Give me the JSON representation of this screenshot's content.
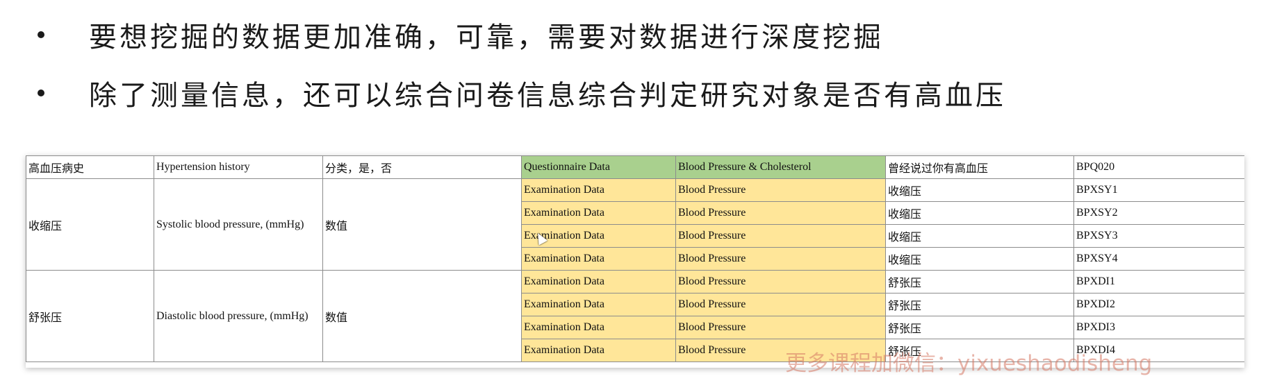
{
  "bullets": [
    {
      "text": "要想挖掘的数据更加准确，可靠，需要对数据进行深度挖掘"
    },
    {
      "text": "除了测量信息，还可以综合问卷信息综合判定研究对象是否有高血压"
    }
  ],
  "table": {
    "row0": [
      "高血压病史",
      "Hypertension history",
      "分类，是，否",
      "Questionnaire Data",
      "Blood Pressure & Cholesterol",
      "曾经说过你有高血压",
      "BPQ020"
    ],
    "systolic_group": {
      "name": "收缩压",
      "desc": "Systolic blood pressure, (mmHg)",
      "type": "数值",
      "rows": [
        [
          "Examination Data",
          "Blood Pressure",
          "收缩压",
          "BPXSY1"
        ],
        [
          "Examination Data",
          "Blood Pressure",
          "收缩压",
          "BPXSY2"
        ],
        [
          "Examination Data",
          "Blood Pressure",
          "收缩压",
          "BPXSY3"
        ],
        [
          "Examination Data",
          "Blood Pressure",
          "收缩压",
          "BPXSY4"
        ]
      ]
    },
    "diastolic_group": {
      "name": "舒张压",
      "desc": "Diastolic blood pressure, (mmHg)",
      "type": "数值",
      "rows": [
        [
          "Examination Data",
          "Blood Pressure",
          "舒张压",
          "BPXDI1"
        ],
        [
          "Examination Data",
          "Blood Pressure",
          "舒张压",
          "BPXDI2"
        ],
        [
          "Examination Data",
          "Blood Pressure",
          "舒张压",
          "BPXDI3"
        ],
        [
          "Examination Data",
          "Blood Pressure",
          "舒张压",
          "BPXDI4"
        ]
      ]
    }
  },
  "watermark": "更多课程加微信：yixueshaodisheng",
  "colors": {
    "questionnaire_fill": "#a9d08e",
    "examination_fill": "#ffe699",
    "watermark": "#d67864"
  }
}
